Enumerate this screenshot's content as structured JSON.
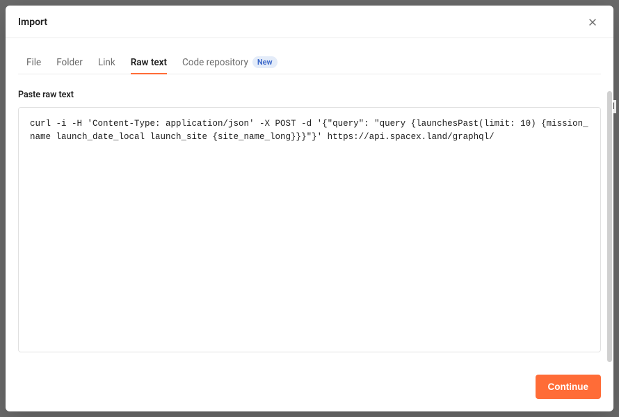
{
  "modal": {
    "title": "Import",
    "close_aria": "Close"
  },
  "tabs": {
    "file": "File",
    "folder": "Folder",
    "link": "Link",
    "raw_text": "Raw text",
    "code_repository": "Code repository",
    "new_badge": "New"
  },
  "form": {
    "label": "Paste raw text",
    "value": "curl -i -H 'Content-Type: application/json' -X POST -d '{\"query\": \"query {launchesPast(limit: 10) {mission_name launch_date_local launch_site {site_name_long}}}\"}' https://api.spacex.land/graphql/"
  },
  "footer": {
    "continue_label": "Continue"
  },
  "colors": {
    "accent": "#ff6c37",
    "badge_bg": "#e4ecf9",
    "badge_fg": "#3a67c9"
  }
}
